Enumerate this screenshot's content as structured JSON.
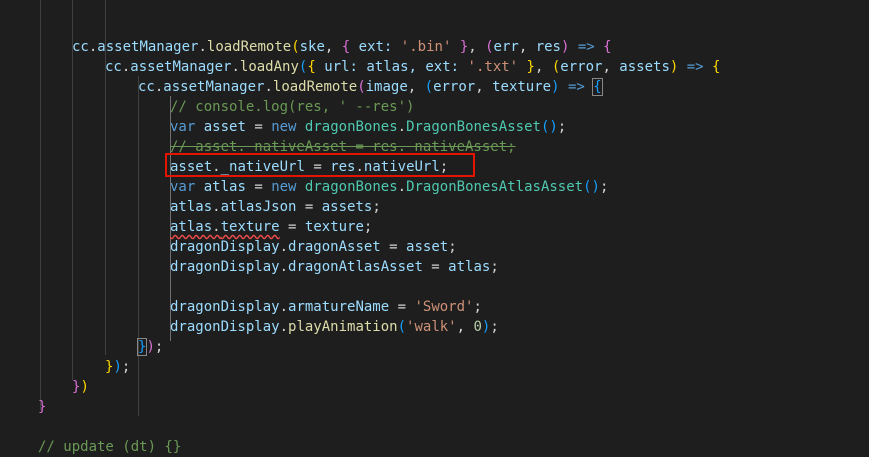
{
  "colors": {
    "background": "#1e1e1e",
    "identifier": "#9cdcfe",
    "function": "#dcdcaa",
    "string": "#ce9178",
    "keyword": "#569cd6",
    "class": "#4ec9b0",
    "number": "#b5cea8",
    "comment": "#6a9955",
    "highlight_border": "#e51400"
  },
  "code": {
    "l1": {
      "a": "cc",
      "b": ".",
      "c": "assetManager",
      "d": ".",
      "e": "loadRemote",
      "f": "(",
      "g": "ske",
      ", ": ", ",
      "h": "{",
      "i": " ext: ",
      "j": "'.bin'",
      "k": " ",
      "l": "}",
      ",": ", ",
      "m": "(",
      "n": "err",
      ",2": ", ",
      "o": "res",
      "p": ")",
      "q": " => ",
      "r": "{"
    },
    "l2": {
      "a": "cc",
      "b": ".",
      "c": "assetManager",
      "d": ".",
      "e": "loadAny",
      "f": "(",
      "g": "{",
      "h": " url: ",
      "i": "atlas",
      ",": ", ext: ",
      "j": "'.txt'",
      "k": " ",
      "l": "}",
      ",2": ", ",
      "m": "(",
      "n": "error",
      ",3": ", ",
      "o": "assets",
      "p": ")",
      "q": " => ",
      "r": "{"
    },
    "l3": {
      "a": "cc",
      "b": ".",
      "c": "assetManager",
      "d": ".",
      "e": "loadRemote",
      "f": "(",
      "g": "image",
      ",": ", ",
      "h": "(",
      "i": "error",
      ",2": ", ",
      "j": "texture",
      "k": ")",
      "l": " => ",
      "m": "{"
    },
    "l4": "// console.log(res, ' --res')",
    "l5": {
      "a": "var",
      "b": " ",
      "c": "asset",
      "d": " = ",
      "e": "new",
      "f": " ",
      "g": "dragonBones",
      "h": ".",
      "i": "DragonBonesAsset",
      "j": "()",
      "k": ";"
    },
    "l6": "// asset._nativeAsset = res._nativeAsset;",
    "l7": {
      "a": "asset",
      "b": ".",
      "c": "_nativeUrl",
      "d": " = ",
      "e": "res",
      "f": ".",
      "g": "nativeUrl",
      "h": ";"
    },
    "l8": {
      "a": "var",
      "b": " ",
      "c": "atlas",
      "d": " = ",
      "e": "new",
      "f": " ",
      "g": "dragonBones",
      "h": ".",
      "i": "DragonBonesAtlasAsset",
      "j": "()",
      "k": ";"
    },
    "l9": {
      "a": "atlas",
      "b": ".",
      "c": "atlasJson",
      "d": " = ",
      "e": "assets",
      "f": ";"
    },
    "l10": {
      "a": "atlas",
      "b": ".",
      "c": "texture",
      "d": " = ",
      "e": "texture",
      "f": ";"
    },
    "l11": {
      "a": "dragonDisplay",
      "b": ".",
      "c": "dragonAsset",
      "d": " = ",
      "e": "asset",
      "f": ";"
    },
    "l12": {
      "a": "dragonDisplay",
      "b": ".",
      "c": "dragonAtlasAsset",
      "d": " = ",
      "e": "atlas",
      "f": ";"
    },
    "l13": {
      "a": "dragonDisplay",
      "b": ".",
      "c": "armatureName",
      "d": " = ",
      "e": "'Sword'",
      "f": ";"
    },
    "l14": {
      "a": "dragonDisplay",
      "b": ".",
      "c": "playAnimation",
      "d": "(",
      "e": "'walk'",
      "f": ", ",
      "g": "0",
      "h": ")",
      "i": ";"
    },
    "l15": {
      "a": "}",
      "b": ")",
      "c": ";"
    },
    "l16": {
      "a": "}",
      "b": ")",
      "c": ";"
    },
    "l17": {
      "a": "}",
      "b": ")"
    },
    "l18": "}",
    "l19": "// update (dt) {}"
  }
}
